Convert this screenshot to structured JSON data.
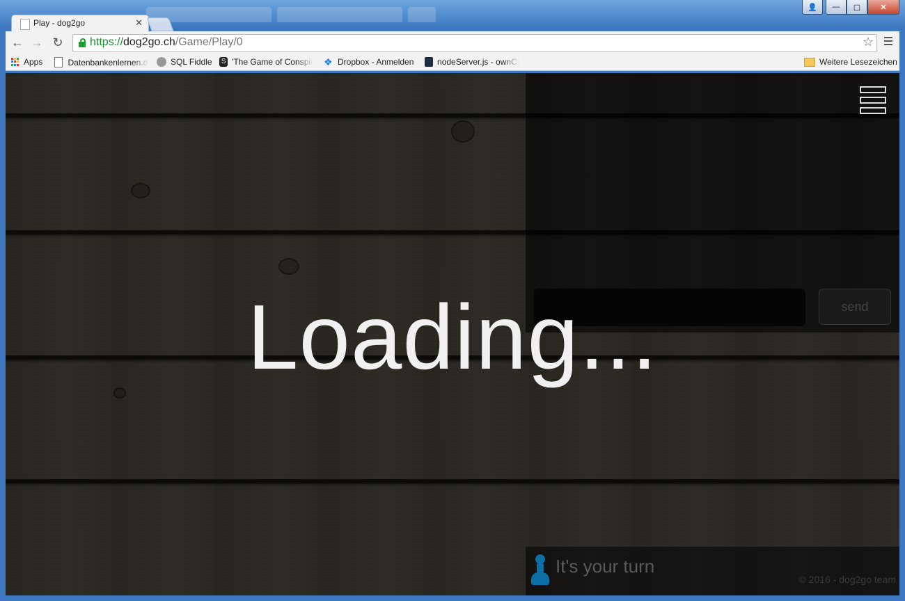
{
  "browser": {
    "tab_title": "Play - dog2go",
    "tab_close": "✕",
    "nav_back": "←",
    "nav_forward": "→",
    "nav_reload": "↻",
    "url_scheme": "https://",
    "url_host": "dog2go.ch",
    "url_path": "/Game/Play/0",
    "star": "☆"
  },
  "bookmarks": {
    "items": [
      {
        "label": "Apps",
        "icon": "apps-icon"
      },
      {
        "label": "Datenbankenlernen.de",
        "icon": "document-icon"
      },
      {
        "label": "SQL Fiddle",
        "icon": "sql-fiddle-icon"
      },
      {
        "label": "'The Game of Conspiracy",
        "icon": "conspiracy-icon"
      },
      {
        "label": "Dropbox - Anmelden",
        "icon": "dropbox-icon"
      },
      {
        "label": "nodeServer.js - ownCloud",
        "icon": "owncloud-icon"
      }
    ],
    "other": "Weitere Lesezeichen"
  },
  "page": {
    "loading_text": "Loading...",
    "chat": {
      "input_value": "",
      "send_label": "send"
    },
    "turn_text": "It's your turn",
    "copyright": "© 2016 - dog2go team"
  },
  "colors": {
    "accent_pawn": "#0d6fa6",
    "url_secure": "#1a8c2a"
  }
}
